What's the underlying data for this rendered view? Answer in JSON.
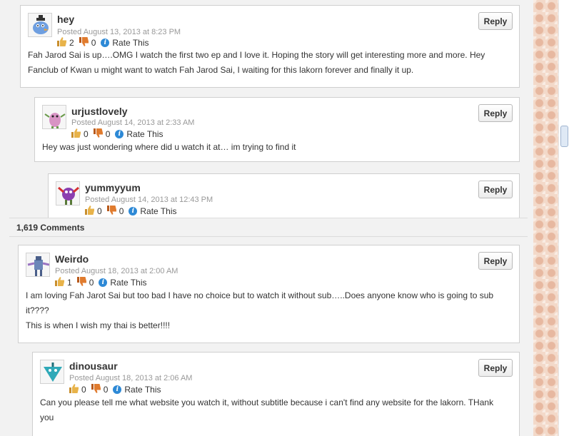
{
  "comments_header": {
    "count_label": "1,619 Comments"
  },
  "comments": [
    {
      "author": "hey",
      "posted": "Posted August 13, 2013 at 8:23 PM",
      "likes": "2",
      "dislikes": "0",
      "rate_label": "Rate This",
      "reply_label": "Reply",
      "avatar": "blue-bird-avatar",
      "body": [
        "Fah Jarod Sai is up….OMG I watch the first two ep and I love it. Hoping the story will get interesting more and more. Hey",
        "Fanclub of Kwan u might want to watch Fah Jarod Sai, I waiting for this lakorn forever and finally it up."
      ]
    },
    {
      "author": "urjustlovely",
      "posted": "Posted August 14, 2013 at 2:33 AM",
      "likes": "0",
      "dislikes": "0",
      "rate_label": "Rate This",
      "reply_label": "Reply",
      "avatar": "pink-creature-avatar",
      "body": [
        "Hey was just wondering where did u watch it at… im trying to find it"
      ]
    },
    {
      "author": "yummyyum",
      "posted": "Posted August 14, 2013 at 12:43 PM",
      "likes": "0",
      "dislikes": "0",
      "rate_label": "Rate This",
      "reply_label": "Reply",
      "avatar": "purple-monster-avatar",
      "body": []
    },
    {
      "author": "Weirdo",
      "posted": "Posted August 18, 2013 at 2:00 AM",
      "likes": "1",
      "dislikes": "0",
      "rate_label": "Rate This",
      "reply_label": "Reply",
      "avatar": "blue-robot-avatar",
      "body": [
        "I am loving Fah Jarot Sai but too bad I have no choice but to watch it without sub…..Does anyone know who is going to sub",
        "it????",
        "This is when I wish my thai is better!!!!"
      ]
    },
    {
      "author": "dinousaur",
      "posted": "Posted August 18, 2013 at 2:06 AM",
      "likes": "0",
      "dislikes": "0",
      "rate_label": "Rate This",
      "reply_label": "Reply",
      "avatar": "teal-drop-avatar",
      "body": [
        "Can you please tell me what website you watch it, without subtitle because i can't find any website for the lakorn. THank",
        "you"
      ]
    }
  ],
  "colors": {
    "page_background": "#f2f2f2",
    "card_background": "#ffffff",
    "card_border": "#cfcfcf",
    "date_text": "#999999",
    "thumb_up": "#e8b34a",
    "thumb_down": "#e07b2e",
    "info_icon": "#2d89d6"
  },
  "icons": {
    "like": "thumbs-up-icon",
    "dislike": "thumbs-down-icon",
    "rate": "info-icon"
  }
}
